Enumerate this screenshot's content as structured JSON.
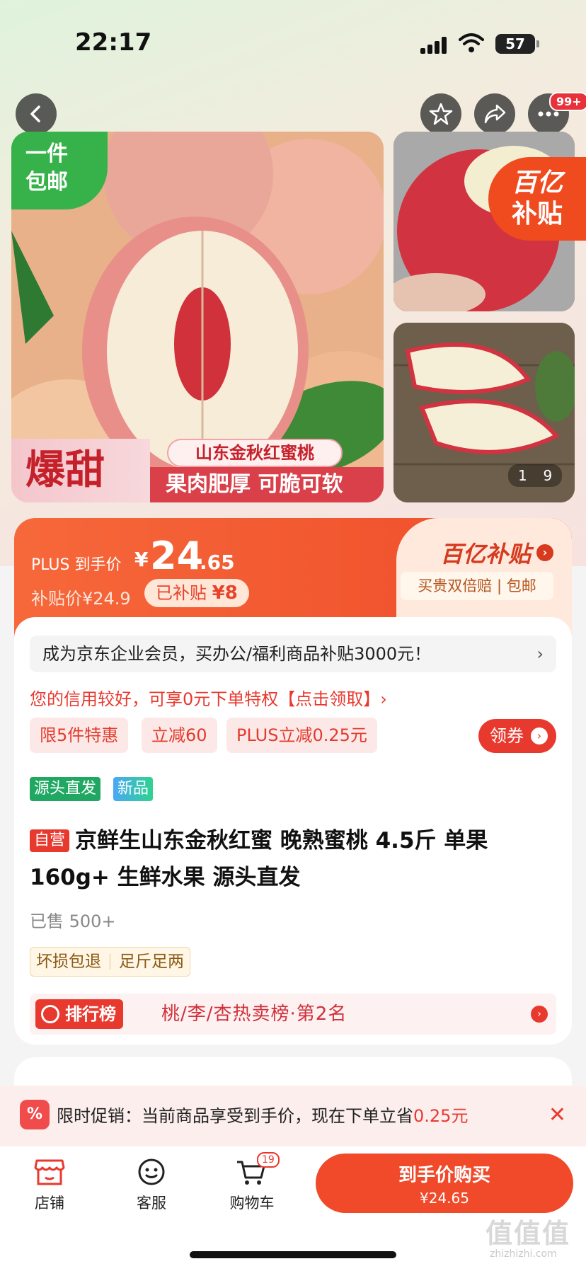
{
  "status": {
    "time": "22:17",
    "battery": "57"
  },
  "nav": {
    "badge": "99+"
  },
  "gallery": {
    "free_shipping": "一件\n包邮",
    "sweet": "爆甜",
    "variety": "山东金秋红蜜桃",
    "flesh": "果肉肥厚 可脆可软",
    "subsidy_tag_l1": "百亿",
    "subsidy_tag_l2": "补贴",
    "counter_current": "1",
    "counter_total": "9"
  },
  "price": {
    "plus_label": "PLUS 到手价",
    "currency": "¥",
    "integer": "24",
    "decimal": ".65",
    "subsidy_price": "补贴价¥24.9",
    "subsidized_label": "已补贴",
    "subsidized_amount": "¥8",
    "bn_logo": "百亿补贴",
    "guarantee": "买贵双倍赔 | 包邮"
  },
  "info": {
    "enterprise": "成为京东企业会员，买办公/福利商品补贴3000元！",
    "credit": "您的信用较好，可享0元下单特权【点击领取】›",
    "promos": [
      "限5件特惠",
      "立减60",
      "PLUS立减0.25元"
    ],
    "coupon": "领券",
    "tag_source": "源头直发",
    "tag_new": "新品",
    "self_operated": "自营",
    "title": "京鲜生山东金秋红蜜 晚熟蜜桃 4.5斤 单果160g+ 生鲜水果 源头直发",
    "sold": "已售 500+",
    "guarantee_1": "坏损包退",
    "guarantee_2": "足斤足两",
    "rank_badge": "排行榜",
    "rank_text": "桃/李/杏热卖榜·第2名"
  },
  "promo_strip": {
    "icon": "%",
    "text": "限时促销：当前商品享受到手价，现在下单立省",
    "amount": "0.25元"
  },
  "bottom": {
    "store": "店铺",
    "service": "客服",
    "cart": "购物车",
    "cart_count": "19",
    "buy_label": "到手价购买",
    "buy_price": "¥24.65"
  },
  "watermark": {
    "main": "值值值",
    "sub": "zhizhizhi.com"
  }
}
